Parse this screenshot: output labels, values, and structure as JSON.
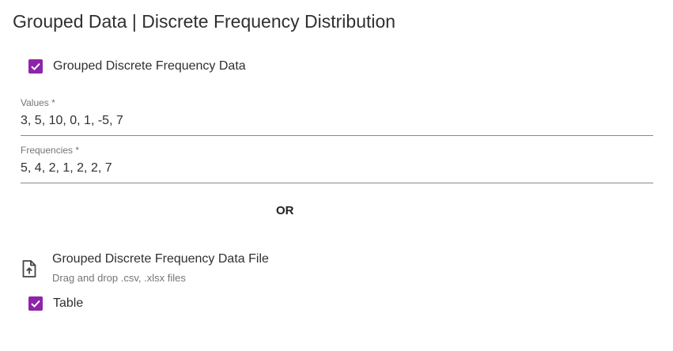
{
  "page": {
    "title": "Grouped Data | Discrete Frequency Distribution"
  },
  "grouped_checkbox": {
    "label": "Grouped Discrete Frequency Data",
    "checked": true
  },
  "values_field": {
    "label": "Values *",
    "value": "3, 5, 10, 0, 1, -5, 7"
  },
  "frequencies_field": {
    "label": "Frequencies *",
    "value": "5, 4, 2, 1, 2, 2, 7"
  },
  "separator": {
    "text": "OR"
  },
  "file_upload": {
    "title": "Grouped Discrete Frequency Data File",
    "subtitle": "Drag and drop .csv, .xlsx files",
    "icon": "file-upload-icon"
  },
  "table_checkbox": {
    "label": "Table",
    "checked": true
  },
  "colors": {
    "accent": "#8e24aa",
    "underline": "#8a8a8a",
    "label": "#757575",
    "text": "#303030"
  }
}
